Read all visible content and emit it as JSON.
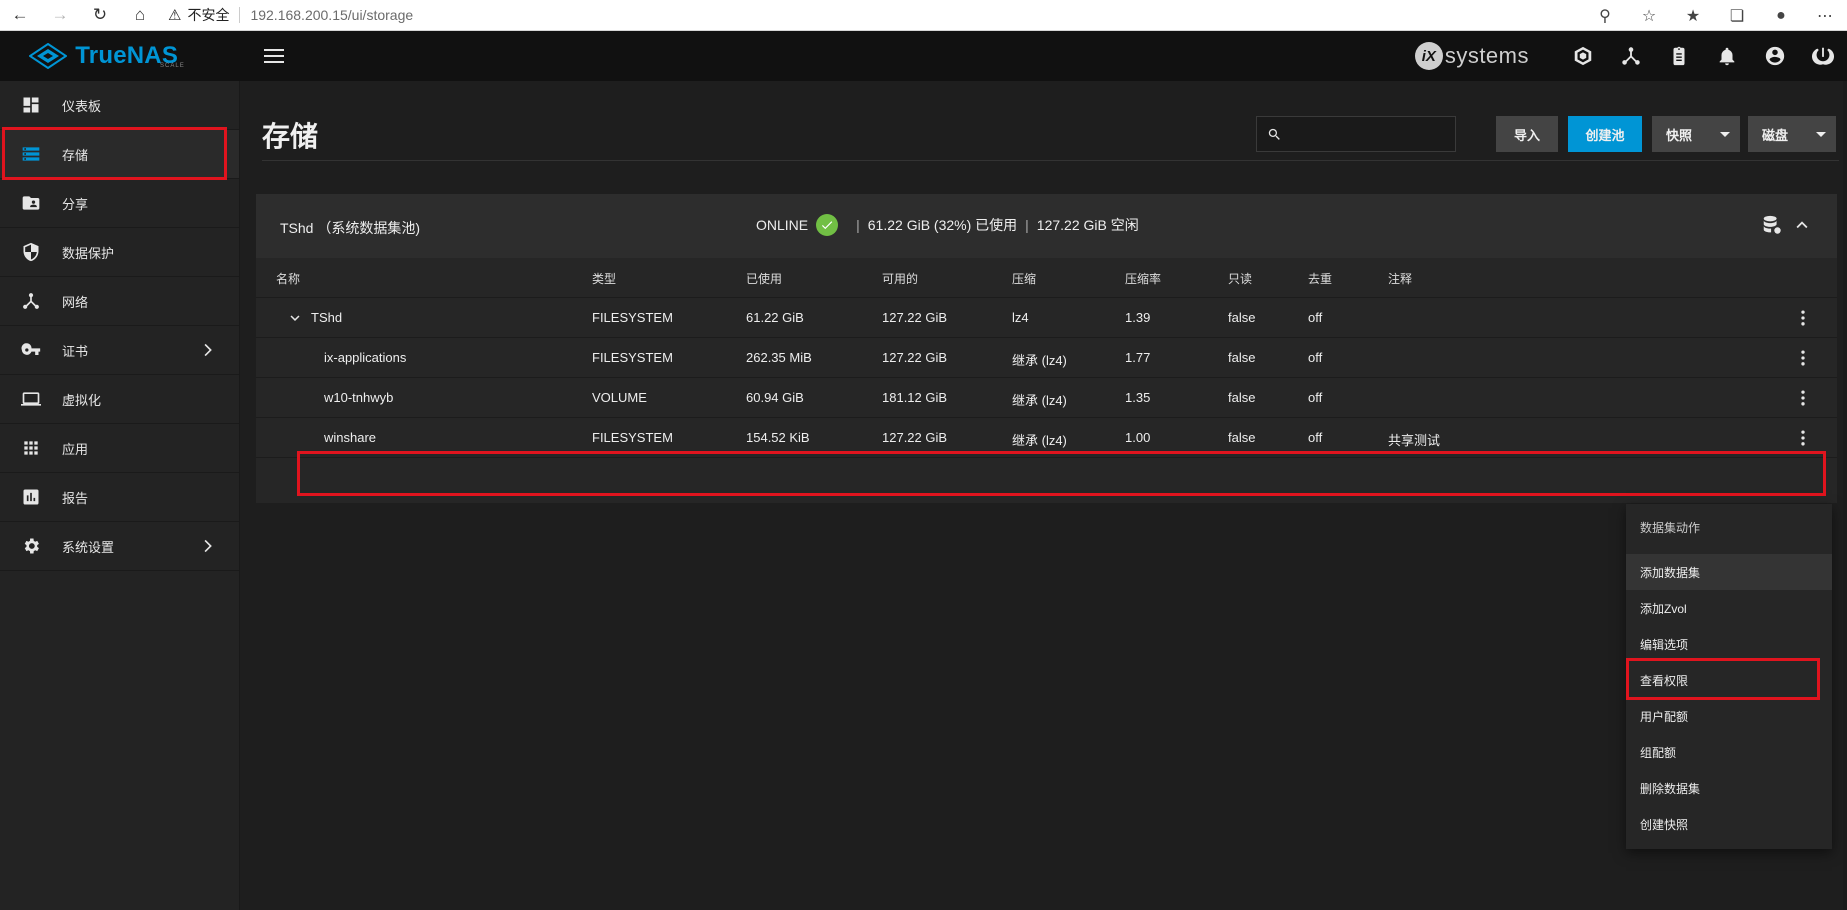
{
  "browser": {
    "security_label": "不安全",
    "url": "192.168.200.15/ui/storage"
  },
  "topbar": {
    "brand": "TrueNAS",
    "brand_sub": "SCALE",
    "ix_mark": "iX",
    "ix_text": "systems"
  },
  "sidebar": {
    "items": [
      {
        "label": "仪表板",
        "icon": "dashboard-icon"
      },
      {
        "label": "存储",
        "icon": "storage-icon"
      },
      {
        "label": "分享",
        "icon": "share-folder-icon"
      },
      {
        "label": "数据保护",
        "icon": "shield-icon"
      },
      {
        "label": "网络",
        "icon": "network-icon"
      },
      {
        "label": "证书",
        "icon": "key-icon"
      },
      {
        "label": "虚拟化",
        "icon": "laptop-icon"
      },
      {
        "label": "应用",
        "icon": "apps-grid-icon"
      },
      {
        "label": "报告",
        "icon": "chart-icon"
      },
      {
        "label": "系统设置",
        "icon": "gear-icon"
      }
    ]
  },
  "page": {
    "title": "存储",
    "search_placeholder": "",
    "buttons": {
      "import": "导入",
      "create_pool": "创建池",
      "snapshots": "快照",
      "disks": "磁盘"
    }
  },
  "pool": {
    "name": "TShd （系统数据集池)",
    "status": "ONLINE",
    "used": "61.22 GiB (32%) 已使用",
    "free": "127.22 GiB 空闲",
    "columns": [
      "名称",
      "类型",
      "已使用",
      "可用的",
      "压缩",
      "压缩率",
      "只读",
      "去重",
      "注释"
    ],
    "rows": [
      {
        "name": "TShd",
        "type": "FILESYSTEM",
        "used": "61.22 GiB",
        "available": "127.22 GiB",
        "compression": "lz4",
        "ratio": "1.39",
        "readonly": "false",
        "dedup": "off",
        "comment": ""
      },
      {
        "name": "ix-applications",
        "type": "FILESYSTEM",
        "used": "262.35 MiB",
        "available": "127.22 GiB",
        "compression": "继承 (lz4)",
        "ratio": "1.77",
        "readonly": "false",
        "dedup": "off",
        "comment": ""
      },
      {
        "name": "w10-tnhwyb",
        "type": "VOLUME",
        "used": "60.94 GiB",
        "available": "181.12 GiB",
        "compression": "继承 (lz4)",
        "ratio": "1.35",
        "readonly": "false",
        "dedup": "off",
        "comment": ""
      },
      {
        "name": "winshare",
        "type": "FILESYSTEM",
        "used": "154.52 KiB",
        "available": "127.22 GiB",
        "compression": "继承 (lz4)",
        "ratio": "1.00",
        "readonly": "false",
        "dedup": "off",
        "comment": "共享测试"
      }
    ]
  },
  "menu": {
    "header": "数据集动作",
    "items": [
      "添加数据集",
      "添加Zvol",
      "编辑选项",
      "查看权限",
      "用户配额",
      "组配额",
      "删除数据集",
      "创建快照"
    ]
  },
  "colors": {
    "accent": "#0095d5",
    "highlight": "#e0141e",
    "online": "#71bf44"
  }
}
